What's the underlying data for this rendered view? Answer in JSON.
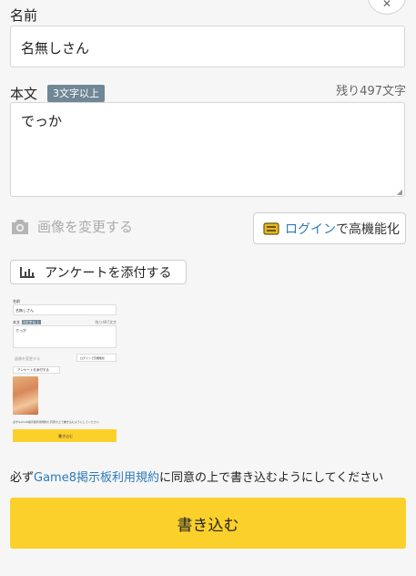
{
  "form": {
    "name_label": "名前",
    "name_value": "名無しさん",
    "body_label": "本文",
    "body_badge": "3文字以上",
    "remaining": "残り497文字",
    "body_value": "でっか",
    "image_change": "画像を変更する",
    "login_link": "ログイン",
    "login_suffix": "で高機能化",
    "survey_button": "アンケートを添付する"
  },
  "thumbnail": {
    "name_label": "名前",
    "name_value": "名無しさん",
    "body_label": "本文",
    "body_badge": "3文字以上",
    "remaining": "残り497文字",
    "body_value": "でっか",
    "image_change": "画像を変更する",
    "login_text": "ログインで高機能化",
    "survey_button": "アンケートを添付する",
    "terms": "必ずGame8掲示板利用規約に同意の上で書き込むようにしてください",
    "submit": "書き込む"
  },
  "terms": {
    "prefix": "必ず",
    "link": "Game8掲示板利用規約",
    "suffix": "に同意の上で書き込むようにしてください"
  },
  "submit_label": "書き込む",
  "colors": {
    "accent": "#fcd02b",
    "link": "#2b7bb9",
    "badge": "#6f8796"
  }
}
